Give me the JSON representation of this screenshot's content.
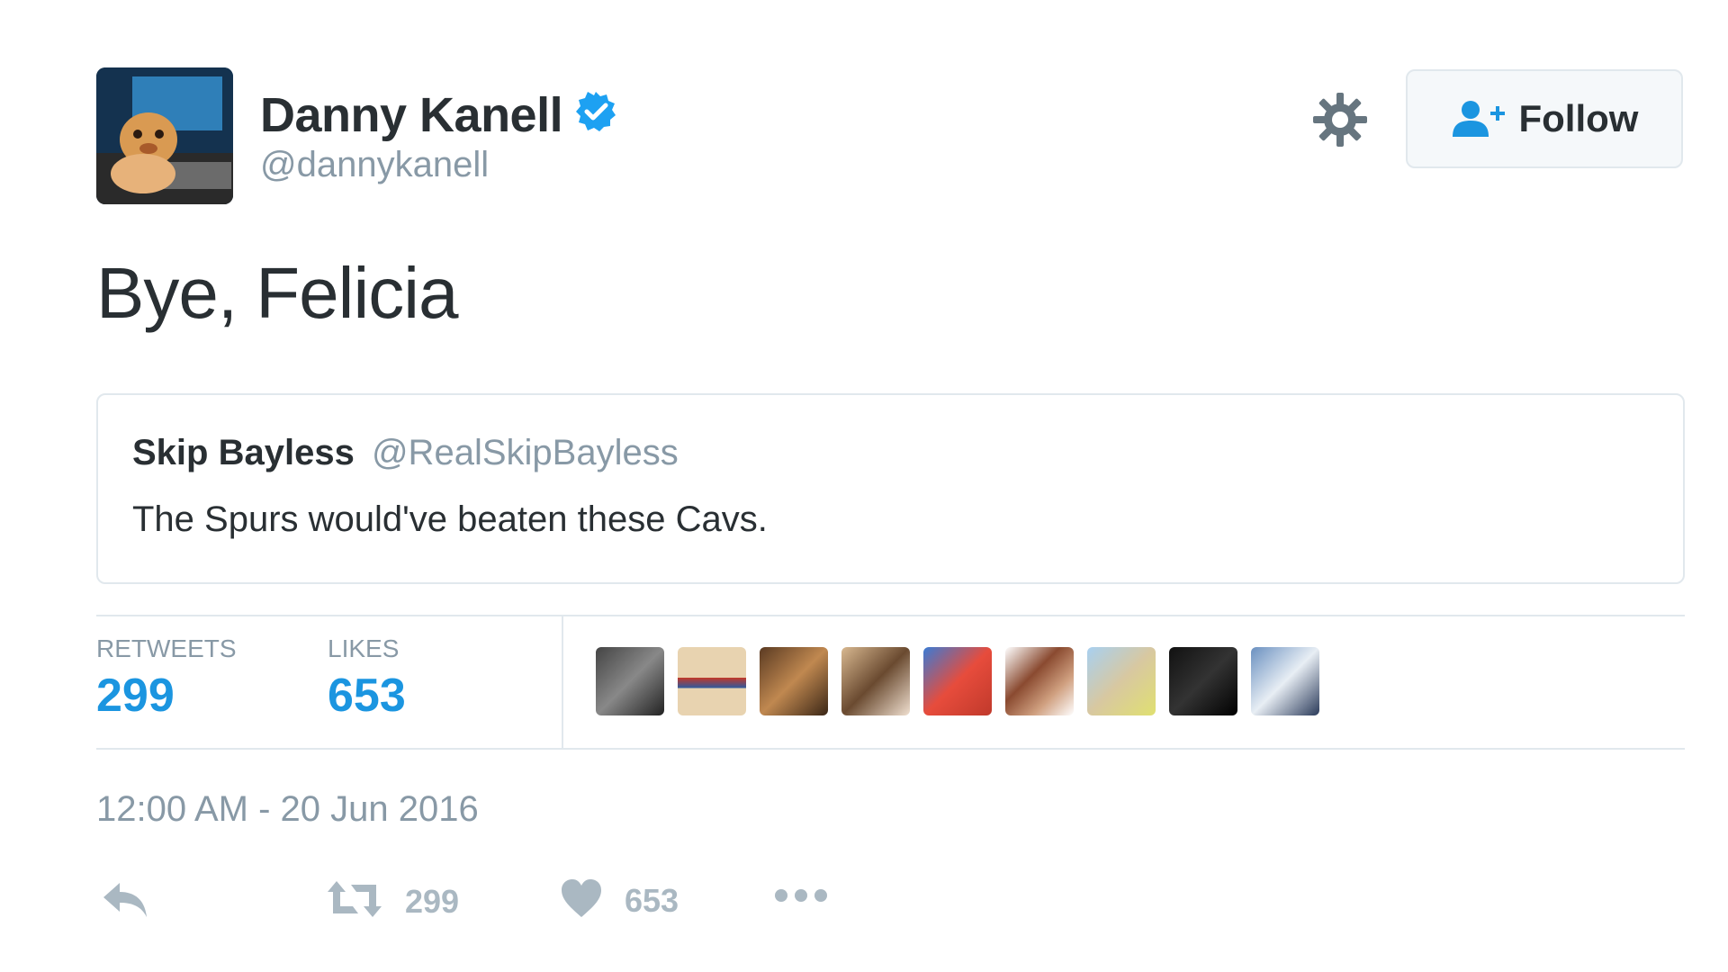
{
  "author": {
    "name": "Danny Kanell",
    "handle": "@dannykanell",
    "verified": true
  },
  "follow_button": {
    "label": "Follow"
  },
  "tweet": {
    "text": "Bye, Felicia",
    "timestamp": "12:00 AM - 20 Jun 2016"
  },
  "quoted_tweet": {
    "name": "Skip Bayless",
    "handle": "@RealSkipBayless",
    "text": "The Spurs would've beaten these Cavs."
  },
  "stats": {
    "retweets_label": "RETWEETS",
    "retweets_value": "299",
    "likes_label": "LIKES",
    "likes_value": "653"
  },
  "actions": {
    "retweet_count": "299",
    "like_count": "653"
  },
  "icons": {
    "verified": "verified-badge-icon",
    "settings": "gear-icon",
    "follow": "add-user-icon",
    "reply": "reply-icon",
    "retweet": "retweet-icon",
    "like": "heart-icon",
    "more": "more-dots-icon"
  },
  "colors": {
    "accent": "#1b95e0",
    "muted": "#8899a6",
    "action": "#aab8c2",
    "border": "#e1e8ed",
    "verified": "#1da1f2"
  }
}
